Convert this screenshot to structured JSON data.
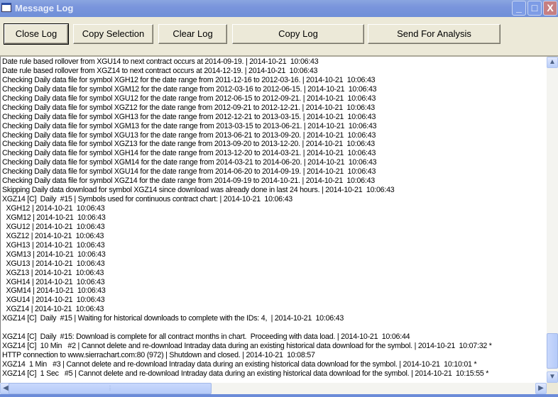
{
  "window": {
    "title": "Message Log",
    "minimize": "_",
    "maximize": "□",
    "close": "X"
  },
  "toolbar": {
    "close_log": "Close Log",
    "copy_selection": "Copy Selection",
    "clear_log": "Clear Log",
    "copy_log": "Copy Log",
    "send_for_analysis": "Send For Analysis"
  },
  "log": {
    "lines": [
      "Date rule based rollover from XGU14 to next contract occurs at 2014-09-19. | 2014-10-21  10:06:43",
      "Date rule based rollover from XGZ14 to next contract occurs at 2014-12-19. | 2014-10-21  10:06:43",
      "Checking Daily data file for symbol XGH12 for the date range from 2011-12-16 to 2012-03-16. | 2014-10-21  10:06:43",
      "Checking Daily data file for symbol XGM12 for the date range from 2012-03-16 to 2012-06-15. | 2014-10-21  10:06:43",
      "Checking Daily data file for symbol XGU12 for the date range from 2012-06-15 to 2012-09-21. | 2014-10-21  10:06:43",
      "Checking Daily data file for symbol XGZ12 for the date range from 2012-09-21 to 2012-12-21. | 2014-10-21  10:06:43",
      "Checking Daily data file for symbol XGH13 for the date range from 2012-12-21 to 2013-03-15. | 2014-10-21  10:06:43",
      "Checking Daily data file for symbol XGM13 for the date range from 2013-03-15 to 2013-06-21. | 2014-10-21  10:06:43",
      "Checking Daily data file for symbol XGU13 for the date range from 2013-06-21 to 2013-09-20. | 2014-10-21  10:06:43",
      "Checking Daily data file for symbol XGZ13 for the date range from 2013-09-20 to 2013-12-20. | 2014-10-21  10:06:43",
      "Checking Daily data file for symbol XGH14 for the date range from 2013-12-20 to 2014-03-21. | 2014-10-21  10:06:43",
      "Checking Daily data file for symbol XGM14 for the date range from 2014-03-21 to 2014-06-20. | 2014-10-21  10:06:43",
      "Checking Daily data file for symbol XGU14 for the date range from 2014-06-20 to 2014-09-19. | 2014-10-21  10:06:43",
      "Checking Daily data file for symbol XGZ14 for the date range from 2014-09-19 to 2014-10-21. | 2014-10-21  10:06:43",
      "Skipping Daily data download for symbol XGZ14 since download was already done in last 24 hours. | 2014-10-21  10:06:43",
      "XGZ14 [C]  Daily  #15 | Symbols used for continuous contract chart: | 2014-10-21  10:06:43",
      "  XGH12 | 2014-10-21  10:06:43",
      "  XGM12 | 2014-10-21  10:06:43",
      "  XGU12 | 2014-10-21  10:06:43",
      "  XGZ12 | 2014-10-21  10:06:43",
      "  XGH13 | 2014-10-21  10:06:43",
      "  XGM13 | 2014-10-21  10:06:43",
      "  XGU13 | 2014-10-21  10:06:43",
      "  XGZ13 | 2014-10-21  10:06:43",
      "  XGH14 | 2014-10-21  10:06:43",
      "  XGM14 | 2014-10-21  10:06:43",
      "  XGU14 | 2014-10-21  10:06:43",
      "  XGZ14 | 2014-10-21  10:06:43",
      "XGZ14 [C]  Daily  #15 | Waiting for historical downloads to complete with the IDs: 4,  | 2014-10-21  10:06:43",
      "",
      "XGZ14 [C]  Daily  #15: Download is complete for all contract months in chart.  Proceeding with data load. | 2014-10-21  10:06:44",
      "XGZ14 [C]  10 Min   #2 | Cannot delete and re-download Intraday data during an existing historical data download for the symbol. | 2014-10-21  10:07:32 *",
      "HTTP connection to www.sierrachart.com:80 (972) | Shutdown and closed. | 2014-10-21  10:08:57",
      "XGZ14  1 Min   #3 | Cannot delete and re-download Intraday data during an existing historical data download for the symbol. | 2014-10-21  10:10:01 *",
      "XGZ14 [C]  1 Sec   #5 | Cannot delete and re-download Intraday data during an existing historical data download for the symbol. | 2014-10-21  10:15:55 *"
    ]
  },
  "scrollbars": {
    "up": "▲",
    "down": "▼",
    "left": "◀",
    "right": "▶",
    "grip": "⋮"
  }
}
